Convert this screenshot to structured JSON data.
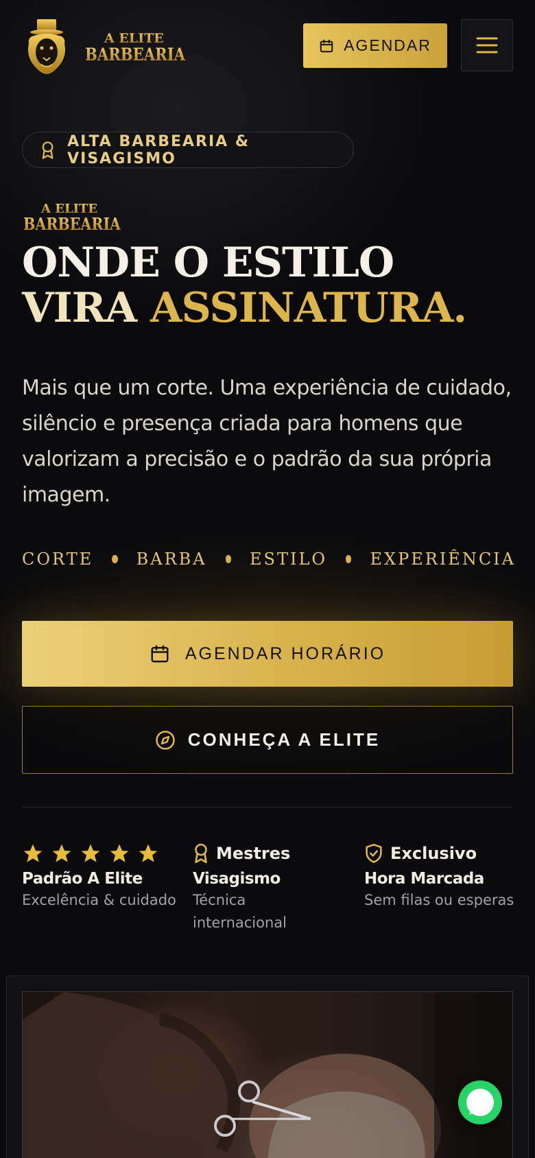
{
  "header": {
    "brand_logo_text_1": "A ELITE",
    "brand_logo_text_2": "BARBEARIA",
    "agendar_label": "AGENDAR"
  },
  "hero": {
    "badge": "ALTA BARBEARIA & VISAGISMO",
    "headline_line1": "ONDE O ESTILO",
    "headline_line2a": "VIRA ",
    "headline_line2b": "ASSINATURA.",
    "description": "Mais que um corte. Uma experiência de cuidado, silêncio e presença criada para homens que valorizam a precisão e o padrão da sua própria imagem.",
    "tags": [
      "CORTE",
      "BARBA",
      "ESTILO",
      "EXPERIÊNCIA"
    ],
    "cta_primary": "AGENDAR HORÁRIO",
    "cta_secondary": "CONHEÇA A ELITE"
  },
  "stats": [
    {
      "head": "",
      "rating": 5,
      "title": "Padrão A Elite",
      "sub": "Excelência & cuidado"
    },
    {
      "head": "Mestres",
      "title": "Visagismo",
      "sub": "Técnica internacional"
    },
    {
      "head": "Exclusivo",
      "title": "Hora Marcada",
      "sub": "Sem filas ou esperas"
    }
  ],
  "colors": {
    "gold": "#d9b24d",
    "gold_light": "#ecd07a",
    "background": "#0b0b0d",
    "whatsapp": "#25d366"
  },
  "icons": {
    "agendar": "calendar-icon",
    "menu": "hamburger-icon",
    "badge": "award-icon",
    "secondary": "compass-icon",
    "stat_rating": "star-icon",
    "stat_mestres": "award-icon",
    "stat_exclusivo": "shield-check-icon",
    "floating": "whatsapp-icon"
  }
}
